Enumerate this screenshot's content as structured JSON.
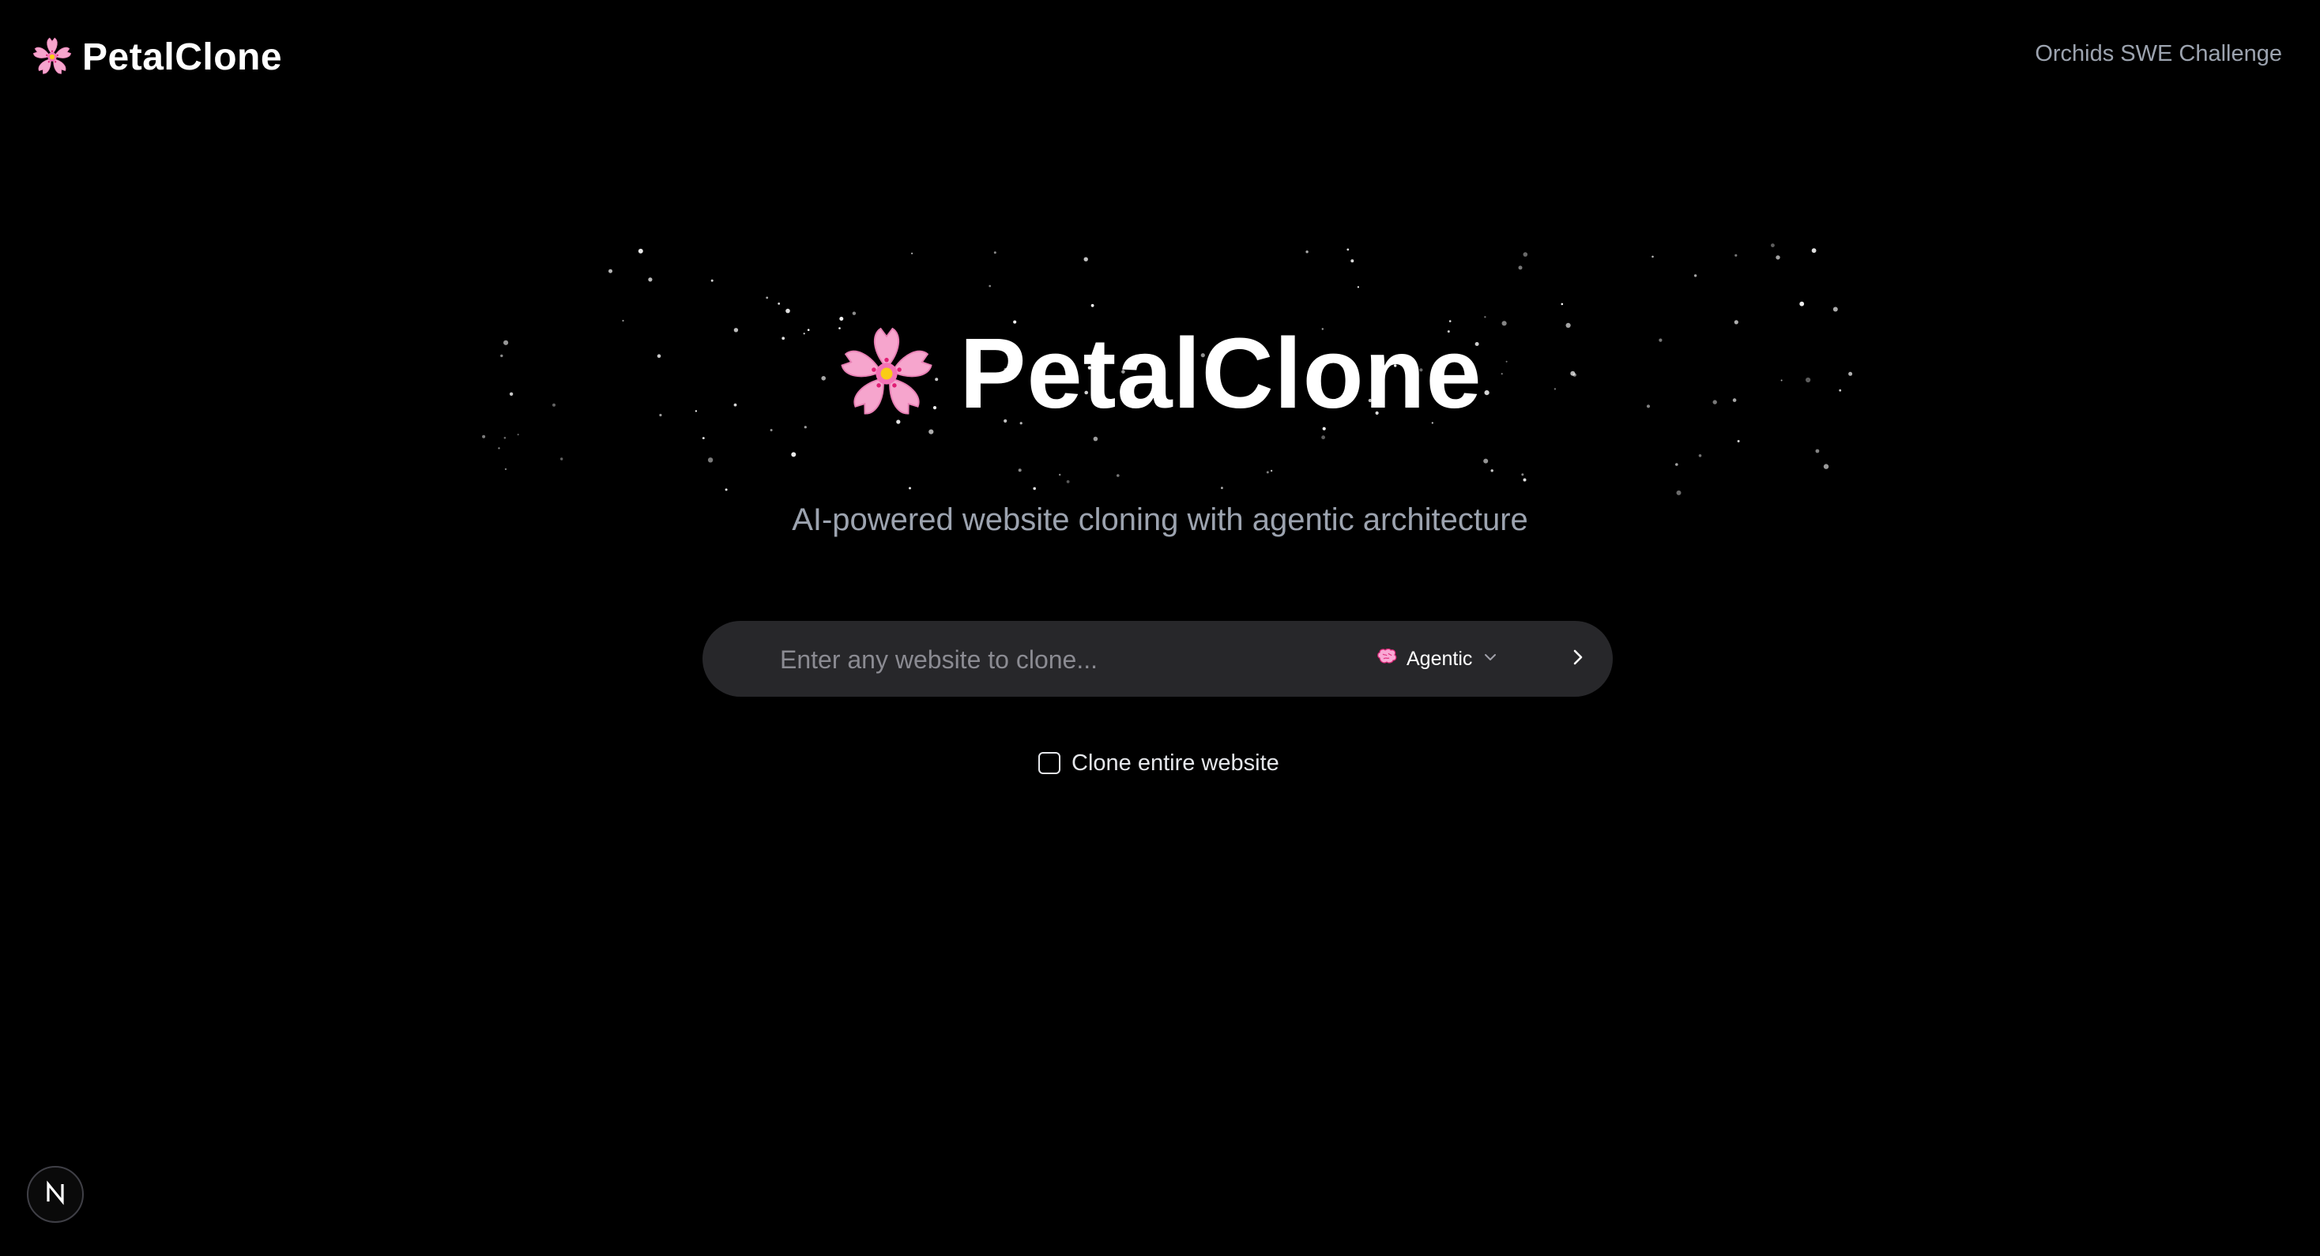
{
  "header": {
    "logo_text": "PetalClone",
    "nav_link": "Orchids SWE Challenge"
  },
  "hero": {
    "title": "PetalClone",
    "subtitle": "AI-powered website cloning with agentic architecture"
  },
  "search": {
    "placeholder": "Enter any website to clone...",
    "value": "",
    "mode_label": "Agentic",
    "mode_icon": "brain-icon",
    "submit_icon": "chevron-right-icon"
  },
  "options": {
    "clone_entire_label": "Clone entire website",
    "clone_entire_checked": false
  },
  "badge": {
    "letter": "N",
    "icon": "nextjs-icon"
  },
  "colors": {
    "background": "#000000",
    "text_primary": "#ffffff",
    "text_muted": "#9ca3af",
    "input_background": "#27272a",
    "flower_pink": "#f9a8d4"
  },
  "icons": {
    "logo": "cherry-blossom-icon"
  }
}
